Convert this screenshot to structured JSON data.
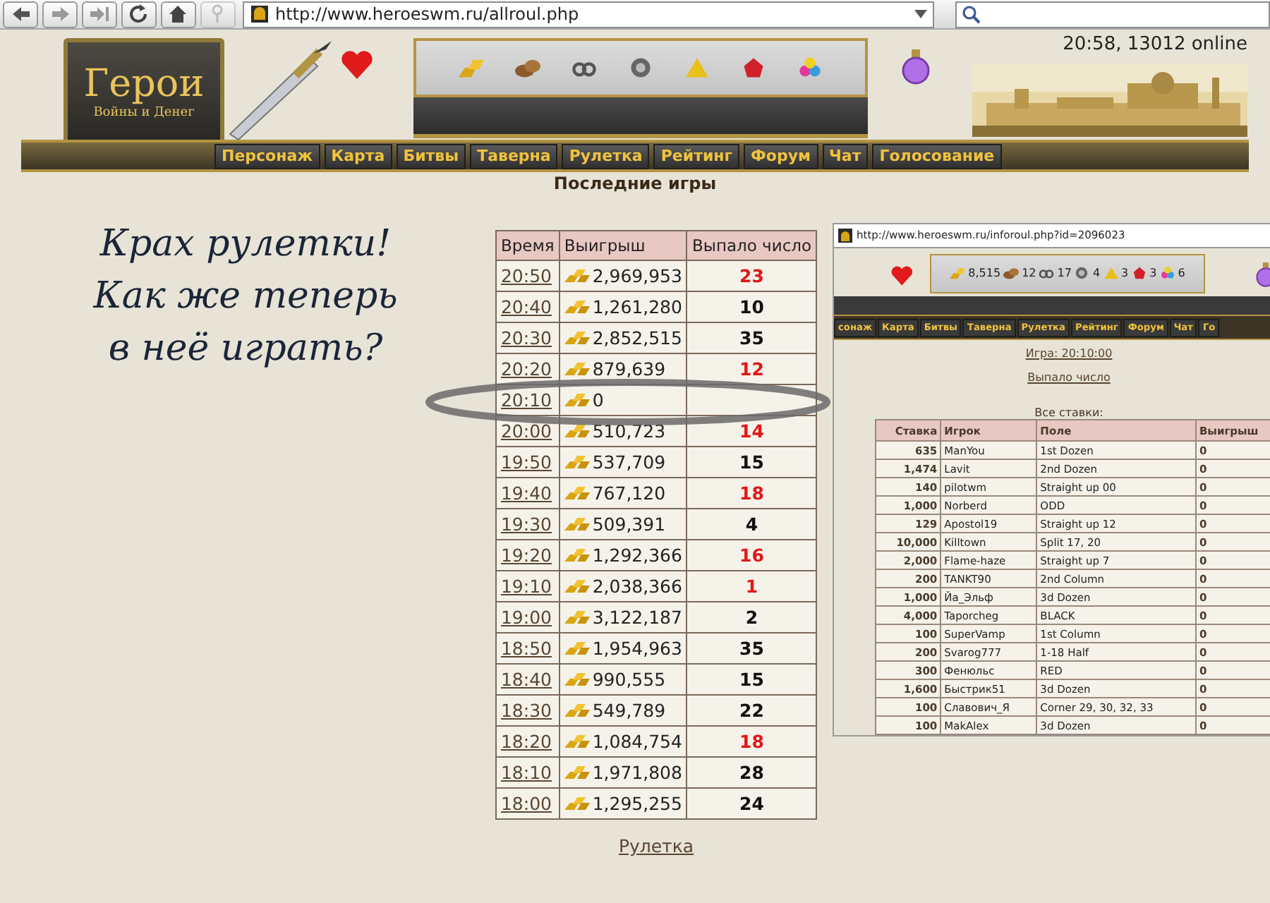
{
  "browser": {
    "address": "http://www.heroeswm.ru/allroul.php"
  },
  "header": {
    "logo_title": "Герои",
    "logo_subtitle": "Войны и Денег",
    "clock": "20:58, 13012 online",
    "menu": [
      "Персонаж",
      "Карта",
      "Битвы",
      "Таверна",
      "Рулетка",
      "Рейтинг",
      "Форум",
      "Чат",
      "Голосование"
    ]
  },
  "page_title": "Последние игры",
  "note": [
    "Крах рулетки!",
    "Как же теперь",
    "в неё играть?"
  ],
  "games": {
    "columns": [
      "Время",
      "Выигрыш",
      "Выпало число"
    ],
    "rows": [
      {
        "time": "20:50",
        "win": "2,969,953",
        "number": "23",
        "color": "#e01818"
      },
      {
        "time": "20:40",
        "win": "1,261,280",
        "number": "10",
        "color": "#101010"
      },
      {
        "time": "20:30",
        "win": "2,852,515",
        "number": "35",
        "color": "#101010"
      },
      {
        "time": "20:20",
        "win": "879,639",
        "number": "12",
        "color": "#e01818"
      },
      {
        "time": "20:10",
        "win": "0"
      },
      {
        "time": "20:00",
        "win": "510,723",
        "number": "14",
        "color": "#e01818"
      },
      {
        "time": "19:50",
        "win": "537,709",
        "number": "15",
        "color": "#101010"
      },
      {
        "time": "19:40",
        "win": "767,120",
        "number": "18",
        "color": "#e01818"
      },
      {
        "time": "19:30",
        "win": "509,391",
        "number": "4",
        "color": "#101010"
      },
      {
        "time": "19:20",
        "win": "1,292,366",
        "number": "16",
        "color": "#e01818"
      },
      {
        "time": "19:10",
        "win": "2,038,366",
        "number": "1",
        "color": "#e01818"
      },
      {
        "time": "19:00",
        "win": "3,122,187",
        "number": "2",
        "color": "#101010"
      },
      {
        "time": "18:50",
        "win": "1,954,963",
        "number": "35",
        "color": "#101010"
      },
      {
        "time": "18:40",
        "win": "990,555",
        "number": "15",
        "color": "#101010"
      },
      {
        "time": "18:30",
        "win": "549,789",
        "number": "22",
        "color": "#101010"
      },
      {
        "time": "18:20",
        "win": "1,084,754",
        "number": "18",
        "color": "#e01818"
      },
      {
        "time": "18:10",
        "win": "1,971,808",
        "number": "28",
        "color": "#101010"
      },
      {
        "time": "18:00",
        "win": "1,295,255",
        "number": "24",
        "color": "#101010"
      }
    ]
  },
  "footer_link": "Рулетка",
  "inset": {
    "address": "http://www.heroeswm.ru/inforoul.php?id=2096023",
    "resources": [
      "8,515",
      "12",
      "17",
      "4",
      "3",
      "3",
      "6"
    ],
    "menu": [
      "сонаж",
      "Карта",
      "Битвы",
      "Таверна",
      "Рулетка",
      "Рейтинг",
      "Форум",
      "Чат",
      "Го"
    ],
    "game_link": "Игра: 20:10:00",
    "result_link": "Выпало число",
    "bets_title": "Все ставки:",
    "bets": {
      "columns": [
        "Ставка",
        "Игрок",
        "Поле",
        "Выигрыш"
      ],
      "rows": [
        [
          "635",
          "ManYou",
          "1st Dozen",
          "0"
        ],
        [
          "1,474",
          "Lavit",
          "2nd Dozen",
          "0"
        ],
        [
          "140",
          "pilotwm",
          "Straight up 00",
          "0"
        ],
        [
          "1,000",
          "Norberd",
          "ODD",
          "0"
        ],
        [
          "129",
          "Apostol19",
          "Straight up 12",
          "0"
        ],
        [
          "10,000",
          "Killtown",
          "Split 17, 20",
          "0"
        ],
        [
          "2,000",
          "Flame-haze",
          "Straight up 7",
          "0"
        ],
        [
          "200",
          "TANKT90",
          "2nd Column",
          "0"
        ],
        [
          "1,000",
          "Йа_Эльф",
          "3d Dozen",
          "0"
        ],
        [
          "4,000",
          "Taporcheg",
          "BLACK",
          "0"
        ],
        [
          "100",
          "SuperVamp",
          "1st Column",
          "0"
        ],
        [
          "200",
          "Svarog777",
          "1-18 Half",
          "0"
        ],
        [
          "300",
          "Фенюльс",
          "RED",
          "0"
        ],
        [
          "1,600",
          "Быстрик51",
          "3d Dozen",
          "0"
        ],
        [
          "100",
          "Славович_Я",
          "Corner 29, 30, 32, 33",
          "0"
        ],
        [
          "100",
          "MakAlex",
          "3d Dozen",
          "0"
        ]
      ]
    }
  }
}
